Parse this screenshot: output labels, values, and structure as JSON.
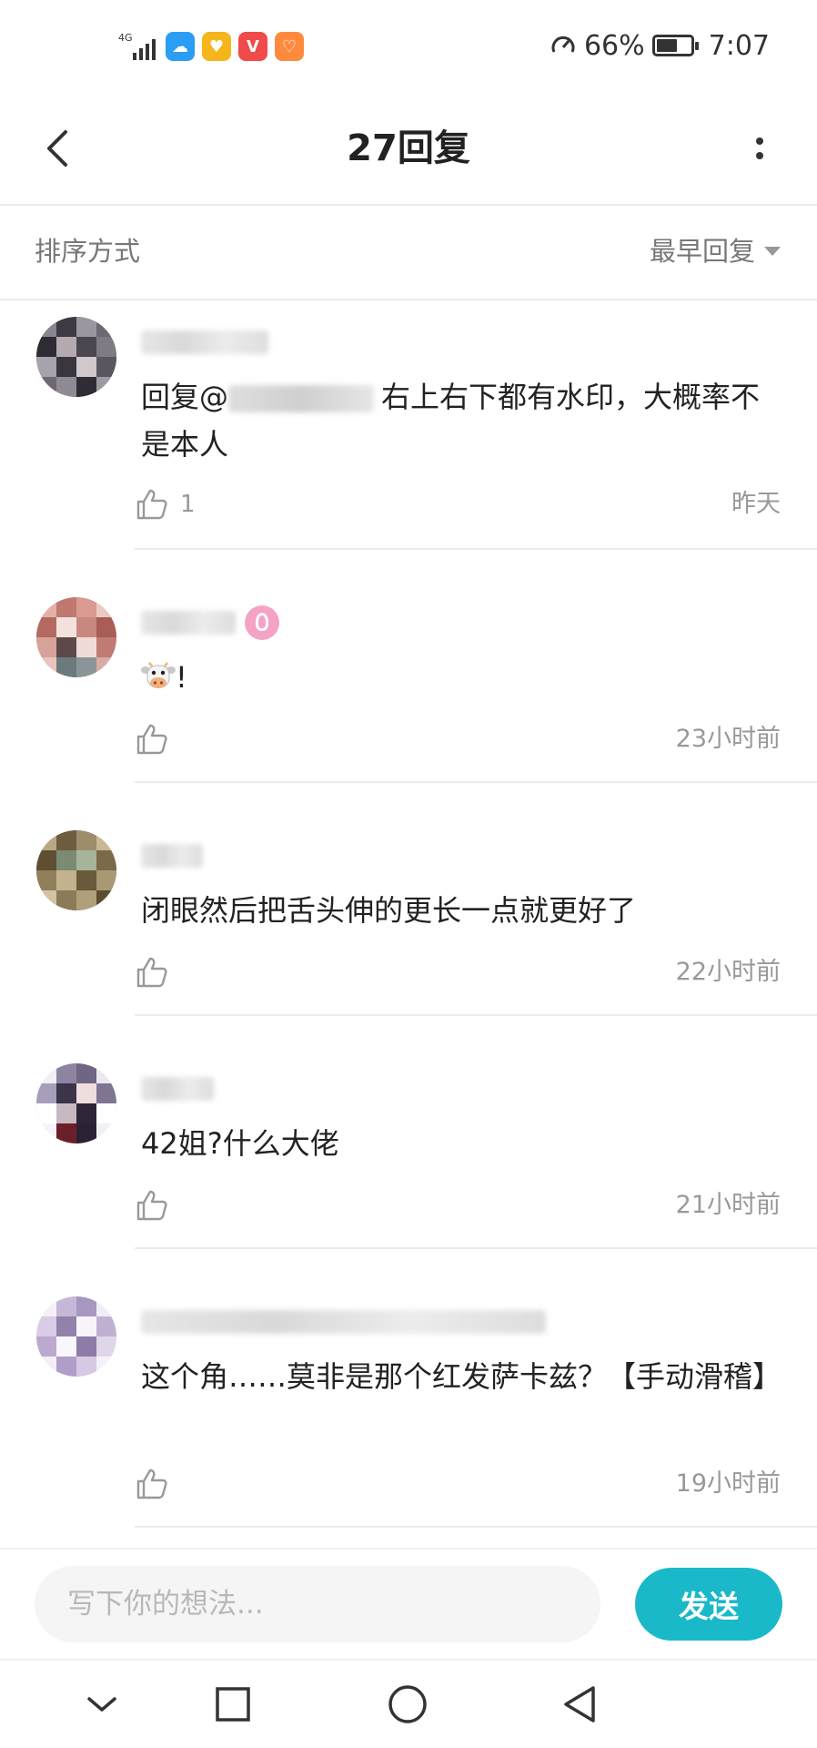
{
  "status_bar": {
    "network": "4G",
    "battery_percent": "66%",
    "battery_level": 0.66,
    "time": "7:07",
    "app_icons": [
      {
        "name": "weather-app-icon",
        "color": "#2a9df4",
        "glyph": "☁"
      },
      {
        "name": "heart-app-icon",
        "color": "#f5b51b",
        "glyph": "♥"
      },
      {
        "name": "v-app-icon",
        "color": "#f04a4a",
        "glyph": "V"
      },
      {
        "name": "gift-app-icon",
        "color": "#ff8a3d",
        "glyph": "♡"
      }
    ]
  },
  "header": {
    "title": "27回复"
  },
  "sort": {
    "label": "排序方式",
    "selected": "最早回复"
  },
  "comments": [
    {
      "mention_prefix": "回复@",
      "content": "右上右下都有水印，大概率不是本人",
      "likes": "1",
      "time": "昨天"
    },
    {
      "content": "!",
      "emoji": "cow-face-emoji",
      "likes": "",
      "time": "23小时前"
    },
    {
      "content": "闭眼然后把舌头伸的更长一点就更好了",
      "likes": "",
      "time": "22小时前"
    },
    {
      "content": "42姐?什么大佬",
      "likes": "",
      "time": "21小时前"
    },
    {
      "content": "这个角……莫非是那个红发萨卡兹？【手动滑稽】",
      "likes": "",
      "time": "19小时前"
    }
  ],
  "reply_bar": {
    "placeholder": "写下你的想法...",
    "send_label": "发送",
    "accent": "#19b9c9"
  }
}
